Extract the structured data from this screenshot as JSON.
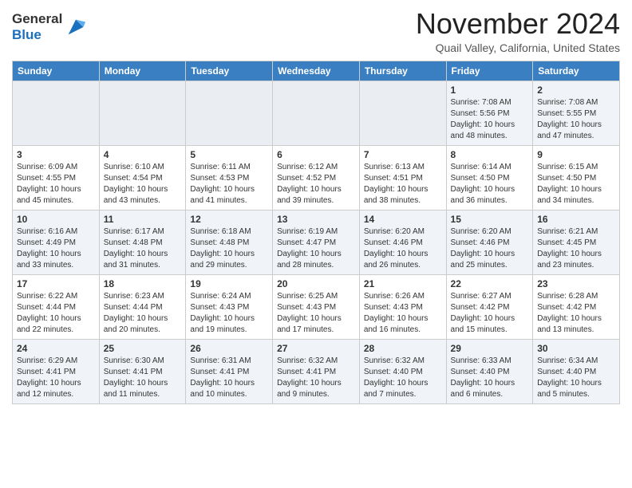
{
  "header": {
    "logo_line1": "General",
    "logo_line2": "Blue",
    "month": "November 2024",
    "location": "Quail Valley, California, United States"
  },
  "weekdays": [
    "Sunday",
    "Monday",
    "Tuesday",
    "Wednesday",
    "Thursday",
    "Friday",
    "Saturday"
  ],
  "weeks": [
    [
      {
        "day": null
      },
      {
        "day": null
      },
      {
        "day": null
      },
      {
        "day": null
      },
      {
        "day": null
      },
      {
        "day": "1",
        "sunrise": "7:08 AM",
        "sunset": "5:56 PM",
        "daylight": "10 hours and 48 minutes."
      },
      {
        "day": "2",
        "sunrise": "7:08 AM",
        "sunset": "5:55 PM",
        "daylight": "10 hours and 47 minutes."
      }
    ],
    [
      {
        "day": "3",
        "sunrise": "6:09 AM",
        "sunset": "4:55 PM",
        "daylight": "10 hours and 45 minutes."
      },
      {
        "day": "4",
        "sunrise": "6:10 AM",
        "sunset": "4:54 PM",
        "daylight": "10 hours and 43 minutes."
      },
      {
        "day": "5",
        "sunrise": "6:11 AM",
        "sunset": "4:53 PM",
        "daylight": "10 hours and 41 minutes."
      },
      {
        "day": "6",
        "sunrise": "6:12 AM",
        "sunset": "4:52 PM",
        "daylight": "10 hours and 39 minutes."
      },
      {
        "day": "7",
        "sunrise": "6:13 AM",
        "sunset": "4:51 PM",
        "daylight": "10 hours and 38 minutes."
      },
      {
        "day": "8",
        "sunrise": "6:14 AM",
        "sunset": "4:50 PM",
        "daylight": "10 hours and 36 minutes."
      },
      {
        "day": "9",
        "sunrise": "6:15 AM",
        "sunset": "4:50 PM",
        "daylight": "10 hours and 34 minutes."
      }
    ],
    [
      {
        "day": "10",
        "sunrise": "6:16 AM",
        "sunset": "4:49 PM",
        "daylight": "10 hours and 33 minutes."
      },
      {
        "day": "11",
        "sunrise": "6:17 AM",
        "sunset": "4:48 PM",
        "daylight": "10 hours and 31 minutes."
      },
      {
        "day": "12",
        "sunrise": "6:18 AM",
        "sunset": "4:48 PM",
        "daylight": "10 hours and 29 minutes."
      },
      {
        "day": "13",
        "sunrise": "6:19 AM",
        "sunset": "4:47 PM",
        "daylight": "10 hours and 28 minutes."
      },
      {
        "day": "14",
        "sunrise": "6:20 AM",
        "sunset": "4:46 PM",
        "daylight": "10 hours and 26 minutes."
      },
      {
        "day": "15",
        "sunrise": "6:20 AM",
        "sunset": "4:46 PM",
        "daylight": "10 hours and 25 minutes."
      },
      {
        "day": "16",
        "sunrise": "6:21 AM",
        "sunset": "4:45 PM",
        "daylight": "10 hours and 23 minutes."
      }
    ],
    [
      {
        "day": "17",
        "sunrise": "6:22 AM",
        "sunset": "4:44 PM",
        "daylight": "10 hours and 22 minutes."
      },
      {
        "day": "18",
        "sunrise": "6:23 AM",
        "sunset": "4:44 PM",
        "daylight": "10 hours and 20 minutes."
      },
      {
        "day": "19",
        "sunrise": "6:24 AM",
        "sunset": "4:43 PM",
        "daylight": "10 hours and 19 minutes."
      },
      {
        "day": "20",
        "sunrise": "6:25 AM",
        "sunset": "4:43 PM",
        "daylight": "10 hours and 17 minutes."
      },
      {
        "day": "21",
        "sunrise": "6:26 AM",
        "sunset": "4:43 PM",
        "daylight": "10 hours and 16 minutes."
      },
      {
        "day": "22",
        "sunrise": "6:27 AM",
        "sunset": "4:42 PM",
        "daylight": "10 hours and 15 minutes."
      },
      {
        "day": "23",
        "sunrise": "6:28 AM",
        "sunset": "4:42 PM",
        "daylight": "10 hours and 13 minutes."
      }
    ],
    [
      {
        "day": "24",
        "sunrise": "6:29 AM",
        "sunset": "4:41 PM",
        "daylight": "10 hours and 12 minutes."
      },
      {
        "day": "25",
        "sunrise": "6:30 AM",
        "sunset": "4:41 PM",
        "daylight": "10 hours and 11 minutes."
      },
      {
        "day": "26",
        "sunrise": "6:31 AM",
        "sunset": "4:41 PM",
        "daylight": "10 hours and 10 minutes."
      },
      {
        "day": "27",
        "sunrise": "6:32 AM",
        "sunset": "4:41 PM",
        "daylight": "10 hours and 9 minutes."
      },
      {
        "day": "28",
        "sunrise": "6:32 AM",
        "sunset": "4:40 PM",
        "daylight": "10 hours and 7 minutes."
      },
      {
        "day": "29",
        "sunrise": "6:33 AM",
        "sunset": "4:40 PM",
        "daylight": "10 hours and 6 minutes."
      },
      {
        "day": "30",
        "sunrise": "6:34 AM",
        "sunset": "4:40 PM",
        "daylight": "10 hours and 5 minutes."
      }
    ]
  ]
}
